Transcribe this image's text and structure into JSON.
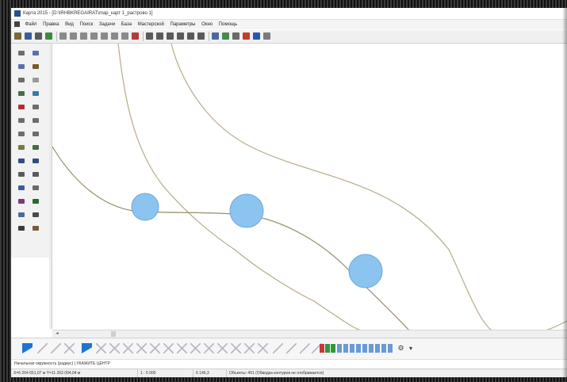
{
  "window": {
    "title": "Карта 2015 - [D:\\IRHBKREGAIRAT\\map_карт 1_растрово 1]"
  },
  "menubar": {
    "items": [
      "Файл",
      "Правка",
      "Вид",
      "Поиск",
      "Задачи",
      "База",
      "Мастерской",
      "Параметры",
      "Окно",
      "Помощь"
    ]
  },
  "toolbar": {
    "buttons": [
      {
        "icon": "open-icon",
        "color": "#7a6a3a"
      },
      {
        "icon": "save-icon",
        "color": "#3c5c9c"
      },
      {
        "icon": "print-icon",
        "color": "#5b5b5b"
      },
      {
        "icon": "layers-icon",
        "color": "#3d8a3d"
      },
      {
        "icon": "select-icon",
        "color": "#8a8a8a"
      },
      {
        "icon": "select-area-icon",
        "color": "#8a8a8a"
      },
      {
        "icon": "pan-icon",
        "color": "#8a8a8a"
      },
      {
        "icon": "rotate-icon",
        "color": "#8a8a8a"
      },
      {
        "icon": "edit-object-icon",
        "color": "#8a8a8a"
      },
      {
        "icon": "measure-icon",
        "color": "#8a8a8a"
      },
      {
        "icon": "vertex-icon",
        "color": "#8a8a8a"
      },
      {
        "icon": "cut-icon",
        "color": "#b23b3b"
      },
      {
        "icon": "zoom-in-icon",
        "color": "#5a5a5a"
      },
      {
        "icon": "zoom-out-icon",
        "color": "#5a5a5a"
      },
      {
        "icon": "zoom-fit-icon",
        "color": "#5a5a5a"
      },
      {
        "icon": "cancel-icon",
        "color": "#5a5a5a"
      },
      {
        "icon": "undo-icon",
        "color": "#5a5a5a"
      },
      {
        "icon": "redo-icon",
        "color": "#5a5a5a"
      },
      {
        "icon": "table-icon",
        "color": "#4a6a9a"
      },
      {
        "icon": "chart-icon",
        "color": "#4a8a4a"
      },
      {
        "icon": "printer-icon",
        "color": "#6a6a6a"
      },
      {
        "icon": "record-icon",
        "color": "#c83a2a"
      },
      {
        "icon": "info-icon",
        "color": "#2456b8"
      },
      {
        "icon": "help-icon",
        "color": "#7a7a7a"
      }
    ]
  },
  "left_toolbox": {
    "tools": [
      {
        "icon": "pointer-icon",
        "color": "#6d6d6d"
      },
      {
        "icon": "line-draw-icon",
        "color": "#5a6fb0"
      },
      {
        "icon": "polyline-icon",
        "color": "#5a6fb0"
      },
      {
        "icon": "curve-icon",
        "color": "#7a5a2a"
      },
      {
        "icon": "vertex-edit-icon",
        "color": "#6d6d6d"
      },
      {
        "icon": "move-icon",
        "color": "#9a9a9a"
      },
      {
        "icon": "grid-icon",
        "color": "#4b6b4b"
      },
      {
        "icon": "link-icon",
        "color": "#3a7aa0"
      },
      {
        "icon": "delete-icon",
        "color": "#b03030"
      },
      {
        "icon": "split-icon",
        "color": "#6d6d6d"
      },
      {
        "icon": "join-icon",
        "color": "#6d6d6d"
      },
      {
        "icon": "trace-icon",
        "color": "#6d6d6d"
      },
      {
        "icon": "rotate-tool-icon",
        "color": "#6d6d6d"
      },
      {
        "icon": "mirror-icon",
        "color": "#6d6d6d"
      },
      {
        "icon": "area-icon",
        "color": "#7a7a3a"
      },
      {
        "icon": "fill-icon",
        "color": "#3f6f3f"
      },
      {
        "icon": "text-icon",
        "color": "#2f4f7f"
      },
      {
        "icon": "label-icon",
        "color": "#2f4f7f"
      },
      {
        "icon": "raster-icon",
        "color": "#5a5a5a"
      },
      {
        "icon": "image-icon",
        "color": "#5a5a5a"
      },
      {
        "icon": "symbol-icon",
        "color": "#3a5fa0"
      },
      {
        "icon": "magnet-icon",
        "color": "#6a6a6a"
      },
      {
        "icon": "snap-icon",
        "color": "#7a3a7a"
      },
      {
        "icon": "graph-icon",
        "color": "#2a6a2a"
      },
      {
        "icon": "table-tool-icon",
        "color": "#4a6a9a"
      },
      {
        "icon": "cursor-icon",
        "color": "#4a4a4a"
      },
      {
        "icon": "frame-icon",
        "color": "#3a3a3a"
      },
      {
        "icon": "photo-icon",
        "color": "#7a5a3a"
      }
    ]
  },
  "bottom_toolbar": {
    "dropdown_label": "▾"
  },
  "status": {
    "message": "Начальная окружность (радиус) | УКАЖИТЕ ЦЕНТР",
    "coordinates": "X=6 264 651,07 м  Y=11 263 004,04 м",
    "scale": "1 : 5 000",
    "value": "6 146,3",
    "object_info": "Объекты: 491 (Обводка контуров не отображается)"
  }
}
